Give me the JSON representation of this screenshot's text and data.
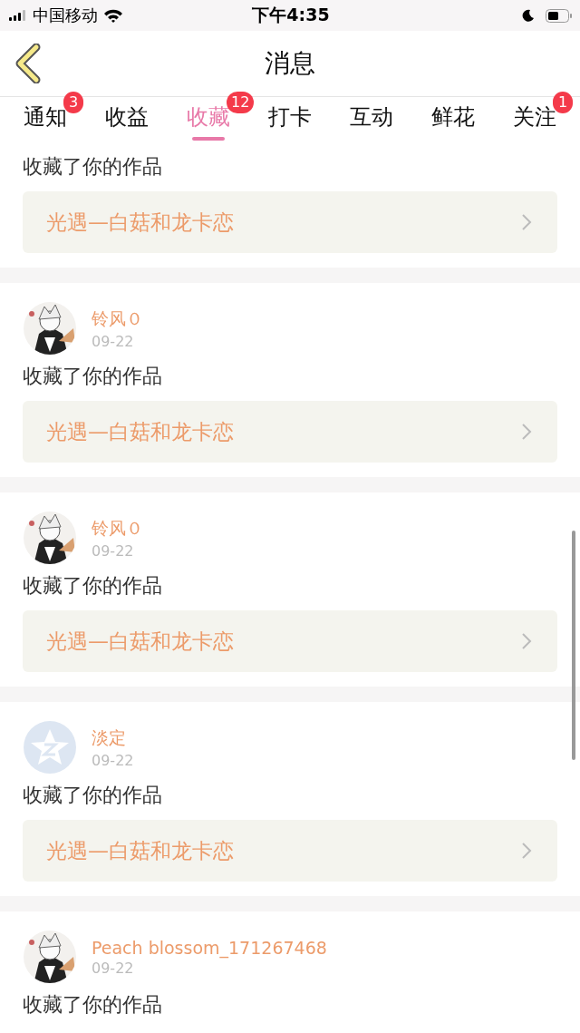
{
  "status_bar": {
    "carrier": "中国移动",
    "time": "下午4:35"
  },
  "header": {
    "title": "消息"
  },
  "tabs": [
    {
      "label": "通知",
      "selected": false,
      "badge": "3"
    },
    {
      "label": "收益",
      "selected": false
    },
    {
      "label": "收藏",
      "selected": true,
      "badge": "12"
    },
    {
      "label": "打卡",
      "selected": false
    },
    {
      "label": "互动",
      "selected": false
    },
    {
      "label": "鲜花",
      "selected": false
    },
    {
      "label": "关注",
      "selected": false,
      "badge": "1"
    }
  ],
  "messages": [
    {
      "message": "收藏了你的作品",
      "work": "光遇—白菇和龙卡恋"
    },
    {
      "user": "铃风０",
      "date": "09-22",
      "message": "收藏了你的作品",
      "work": "光遇—白菇和龙卡恋"
    },
    {
      "user": "铃风０",
      "date": "09-22",
      "message": "收藏了你的作品",
      "work": "光遇—白菇和龙卡恋"
    },
    {
      "avatar": {
        "kind": "default"
      },
      "user": "淡定",
      "date": "09-22",
      "message": "收藏了你的作品",
      "work": "光遇—白菇和龙卡恋"
    },
    {
      "user": "Peach blossom_171267468",
      "date": "09-22",
      "message": "收藏了你的作品"
    }
  ]
}
